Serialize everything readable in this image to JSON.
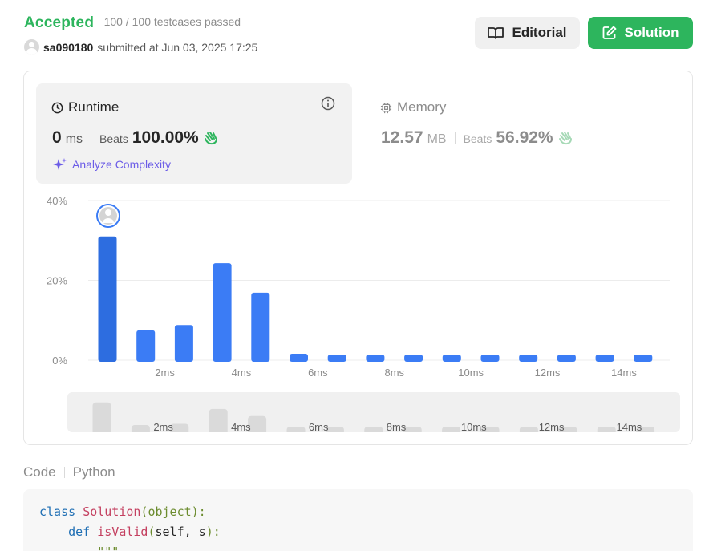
{
  "header": {
    "status": "Accepted",
    "testcases": "100 / 100 testcases passed",
    "username": "sa090180",
    "submitted": "submitted at Jun 03, 2025 17:25",
    "editorial_label": "Editorial",
    "solution_label": "Solution"
  },
  "runtime": {
    "title": "Runtime",
    "value": "0",
    "unit": "ms",
    "beats_label": "Beats",
    "beats_value": "100.00%",
    "analyze_label": "Analyze Complexity"
  },
  "memory": {
    "title": "Memory",
    "value": "12.57",
    "unit": "MB",
    "beats_label": "Beats",
    "beats_value": "56.92%"
  },
  "colors": {
    "accepted": "#2db55d",
    "bar": "#3b7cf5",
    "bar_selected": "#2d6de0",
    "analyze": "#6b5ce7"
  },
  "chart_data": {
    "type": "bar",
    "title": "",
    "xlabel": "",
    "ylabel": "",
    "ylim": [
      0,
      40
    ],
    "yticks": [
      "40%",
      "20%",
      "0%"
    ],
    "ytick_values": [
      40,
      20,
      0
    ],
    "xtick_labels": [
      "2ms",
      "4ms",
      "6ms",
      "8ms",
      "10ms",
      "12ms",
      "14ms"
    ],
    "categories": [
      0,
      1,
      2,
      3,
      4,
      5,
      6,
      7,
      8,
      9,
      10,
      11,
      12,
      13,
      14
    ],
    "values": [
      31,
      7.5,
      8.8,
      24.3,
      16.9,
      1.6,
      1.4,
      1.4,
      1.4,
      1.4,
      1.4,
      1.4,
      1.4,
      1.4,
      1.4
    ],
    "selected_index": 0,
    "grid": true
  },
  "code": {
    "tab_label": "Code",
    "language": "Python",
    "lines": [
      [
        [
          "kw",
          "class "
        ],
        [
          "cls",
          "Solution"
        ],
        [
          "builtin",
          "("
        ],
        [
          "builtin",
          "object"
        ],
        [
          "builtin",
          "):"
        ]
      ],
      [
        [
          "plain",
          "    "
        ],
        [
          "kw",
          "def "
        ],
        [
          "fn",
          "isValid"
        ],
        [
          "builtin",
          "("
        ],
        [
          "plain",
          "self, s"
        ],
        [
          "builtin",
          "):"
        ]
      ],
      [
        [
          "plain",
          "        "
        ],
        [
          "str",
          "\"\"\""
        ]
      ]
    ]
  }
}
